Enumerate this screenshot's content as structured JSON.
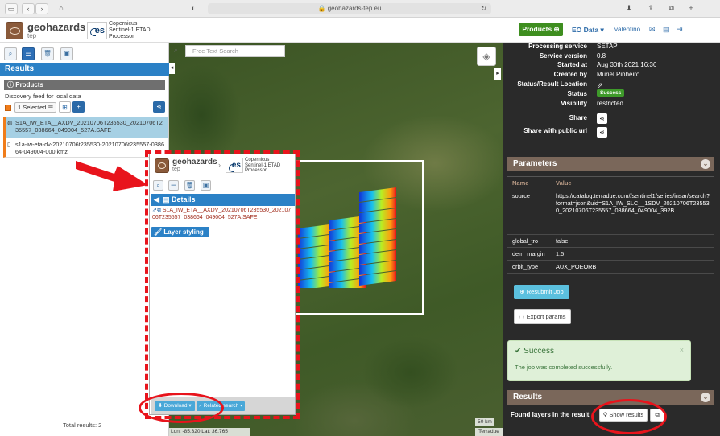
{
  "browser": {
    "url": "geohazards-tep.eu"
  },
  "header": {
    "brand_name": "geohazards",
    "brand_sub": "tep",
    "processor_l1": "Copernicus",
    "processor_l2": "Sentinel-1 ETAD",
    "processor_l3": "Processor",
    "products_label": "Products",
    "eo_data_label": "EO Data",
    "user_label": "valentino"
  },
  "left": {
    "results_title": "Results",
    "products_label": "Products",
    "discovery_text": "Discovery feed for local data",
    "selected_label": "1 Selected",
    "items": [
      {
        "name": "S1A_IW_ETA__AXDV_20210706T235530_20210706T235557_038664_049004_527A.SAFE"
      },
      {
        "name": "s1a-iw-eta-dv-20210706t235530-20210706t235557-038664-049004-000.kmz"
      }
    ],
    "total_results": "Total results: 2"
  },
  "map": {
    "search_placeholder": "Free Text Search",
    "scale_label": "50 km",
    "coords": "Lon: -85.320 Lat: 36.765",
    "attribution": "Terradue"
  },
  "overlay": {
    "details_label": "Details",
    "item_name": "S1A_IW_ETA__AXDV_20210706T235530_20210706T235557_038664_049004_527A.SAFE",
    "layer_styling": "Layer styling",
    "download_label": "Download",
    "related_label": "Related search"
  },
  "right": {
    "info": [
      {
        "k": "Processing service",
        "v": "SETAP"
      },
      {
        "k": "Service version",
        "v": "0.8"
      },
      {
        "k": "Started at",
        "v": "Aug 30th 2021 16:36"
      },
      {
        "k": "Created by",
        "v": "Muriel Pinheiro"
      },
      {
        "k": "Status/Result Location",
        "v": ""
      },
      {
        "k": "Status",
        "v": "Success"
      },
      {
        "k": "Visibility",
        "v": "restricted"
      },
      {
        "k": "Share",
        "v": ""
      },
      {
        "k": "Share with public url",
        "v": ""
      }
    ],
    "parameters_title": "Parameters",
    "param_col_name": "Name",
    "param_col_value": "Value",
    "params": [
      {
        "name": "source",
        "value": "https://catalog.terradue.com//sentinel1/series/insar/search?format=json&uid=S1A_IW_SLC__1SDV_20210706T235530_20210706T235557_038664_049004_392B"
      },
      {
        "name": "global_tro",
        "value": "false"
      },
      {
        "name": "dem_margin",
        "value": "1.5"
      },
      {
        "name": "orbit_type",
        "value": "AUX_POEORB"
      }
    ],
    "resubmit_label": "Resubmit Job",
    "export_label": "Export params",
    "success_title": "Success",
    "success_text": "The job was completed successfully.",
    "results_title": "Results",
    "found_label": "Found layers in the result",
    "show_results_label": "Show results"
  },
  "colors": {
    "accent_blue": "#2b81c6",
    "success_green": "#3e8e1f",
    "annotation_red": "#e8141c",
    "panel_dark": "#2a2a2a"
  }
}
